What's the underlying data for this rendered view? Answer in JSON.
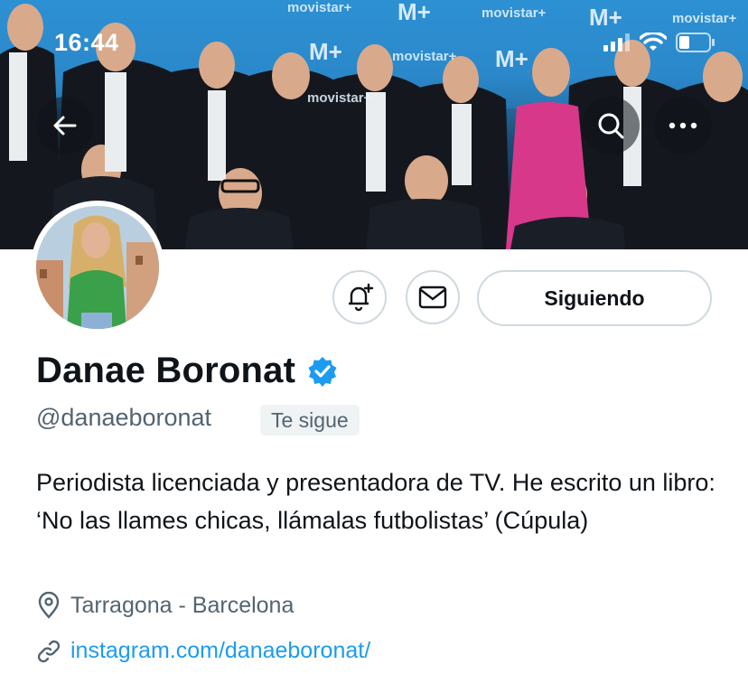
{
  "status_bar": {
    "time": "16:44"
  },
  "banner": {
    "brand_texts": [
      "movistar+",
      "movistar+",
      "movistar+",
      "movistar+",
      "movistar+"
    ],
    "logo_mark": "M+"
  },
  "header": {
    "back_icon": "arrow-left-icon",
    "search_icon": "search-icon",
    "more_icon": "more-horizontal-icon"
  },
  "actions": {
    "notify_icon": "bell-plus-icon",
    "message_icon": "envelope-icon",
    "follow_label": "Siguiendo"
  },
  "profile": {
    "name": "Danae Boronat",
    "verified_icon": "verified-badge-icon",
    "verified_color": "#1d9bf0",
    "handle": "@danaeboronat",
    "follows_you": "Te sigue",
    "bio": "Periodista licenciada y presentadora de TV. He escrito un libro: ‘No las llames chicas, llámalas futbolistas’ (Cúpula)",
    "location": "Tarragona - Barcelona",
    "location_icon": "location-pin-icon",
    "website": "instagram.com/danaeboronat/",
    "website_icon": "link-icon",
    "link_color": "#1d9bf0"
  }
}
